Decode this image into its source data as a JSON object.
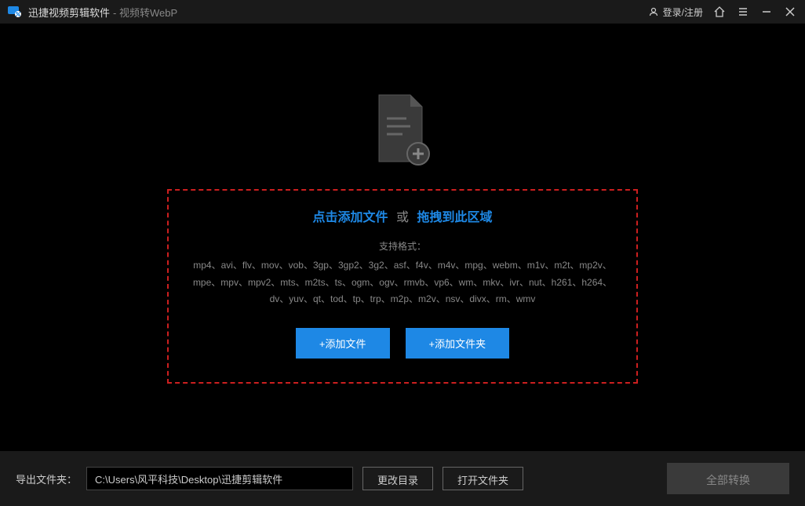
{
  "titlebar": {
    "app_name": "迅捷视频剪辑软件",
    "subtitle": "- 视频转WebP",
    "login_text": "登录/注册"
  },
  "dropzone": {
    "click_text": "点击添加文件",
    "or_text": "或",
    "drag_text": "拖拽到此区域",
    "support_label": "支持格式：",
    "formats": "mp4、avi、flv、mov、vob、3gp、3gp2、3g2、asf、f4v、m4v、mpg、webm、m1v、m2t、mp2v、mpe、mpv、mpv2、mts、m2ts、ts、ogm、ogv、rmvb、vp6、wm、mkv、ivr、nut、h261、h264、dv、yuv、qt、tod、tp、trp、m2p、m2v、nsv、divx、rm、wmv",
    "add_file_btn": "+添加文件",
    "add_folder_btn": "+添加文件夹"
  },
  "footer": {
    "output_label": "导出文件夹：",
    "output_path": "C:\\Users\\风平科技\\Desktop\\迅捷剪辑软件",
    "change_dir_btn": "更改目录",
    "open_folder_btn": "打开文件夹",
    "convert_all_btn": "全部转换"
  }
}
